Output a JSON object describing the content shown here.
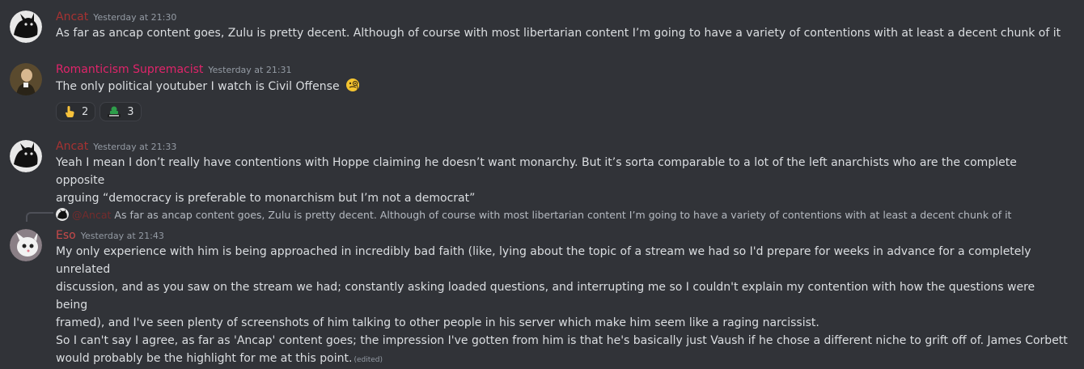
{
  "colors": {
    "background": "#313338",
    "ancat_name": "#a63232",
    "romanticism_name": "#e0246a",
    "eso_name": "#c94a4a"
  },
  "messages": [
    {
      "author": "Ancat",
      "timestamp": "Yesterday at 21:30",
      "text": "As far as ancap content goes, Zulu is pretty decent. Although of course with most libertarian content I’m going to have a variety of contentions with at least a decent chunk of it"
    },
    {
      "author": "Romanticism Supremacist",
      "timestamp": "Yesterday at 21:31",
      "text": "The only political youtuber I watch is Civil Offense",
      "reactions": [
        {
          "icon": "pointing-hand-emoji",
          "count": "2"
        },
        {
          "icon": "halal-emoji",
          "count": "3"
        }
      ]
    },
    {
      "author": "Ancat",
      "timestamp": "Yesterday at 21:33",
      "text_line1": "Yeah I mean I don’t really have contentions with Hoppe claiming he doesn’t want monarchy. But it’s sorta comparable to a lot of the left anarchists who are the complete opposite",
      "text_line2": "arguing “democracy is preferable to monarchism but I’m not a democrat”"
    },
    {
      "reply": {
        "mention": "@Ancat",
        "text": "As far as ancap content goes, Zulu is pretty decent. Although of course with most libertarian content I’m going to have a variety of contentions with at least a decent chunk of it"
      },
      "author": "Eso",
      "timestamp": "Yesterday at 21:43",
      "lines": [
        "My only experience with him is being approached in incredibly bad faith (like, lying about the topic of a stream we had so I'd prepare for weeks in advance for a completely unrelated",
        "discussion, and as you saw on the stream we had; constantly asking loaded questions, and interrupting me so I couldn't explain my contention with how the questions were being",
        "framed), and I've seen plenty of screenshots of him talking to other people in his server which make him seem like a raging narcissist.",
        "So I can't say I agree, as far as 'Ancap' content goes; the impression I've gotten from him is that he's basically just Vaush if he chose a different niche to grift off of. James Corbett",
        "would probably be the highlight for me at this point."
      ],
      "edited": "(edited)"
    }
  ]
}
